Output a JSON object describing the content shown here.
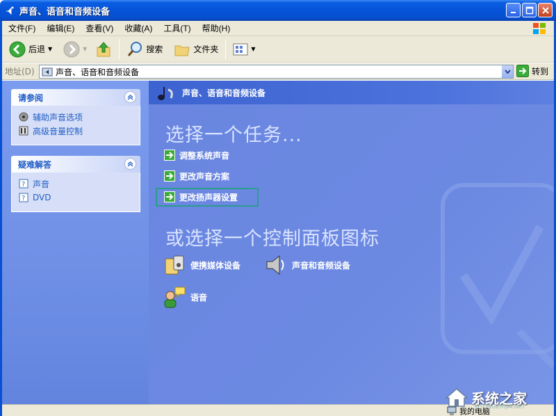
{
  "window": {
    "title": "声音、语音和音频设备"
  },
  "menu": {
    "items": [
      "文件(F)",
      "编辑(E)",
      "查看(V)",
      "收藏(A)",
      "工具(T)",
      "帮助(H)"
    ]
  },
  "toolbar": {
    "back_label": "后退",
    "search_label": "搜索",
    "folders_label": "文件夹"
  },
  "address": {
    "label": "地址(D)",
    "value": "声音、语音和音频设备",
    "go_label": "转到"
  },
  "left": {
    "see_also": {
      "title": "请参阅",
      "items": [
        "辅助声音选项",
        "高级音量控制"
      ]
    },
    "troubleshoot": {
      "title": "疑难解答",
      "items": [
        "声音",
        "DVD"
      ]
    }
  },
  "main": {
    "header": "声音、语音和音频设备",
    "pick_task": "选择一个任务...",
    "tasks": [
      "调整系统声音",
      "更改声音方案",
      "更改扬声器设置"
    ],
    "pick_icon": "或选择一个控制面板图标",
    "icons": [
      "便携媒体设备",
      "声音和音频设备",
      "语音"
    ]
  },
  "status": {
    "zone": "我的电脑",
    "brand": "系统之家",
    "brand_url": "XITONGZHIJIA.NET"
  },
  "colors": {
    "title_blue": "#0654d8",
    "panel_blue": "#6c89e2",
    "link_blue": "#215dc6",
    "focus_teal": "#2b9c8e"
  }
}
